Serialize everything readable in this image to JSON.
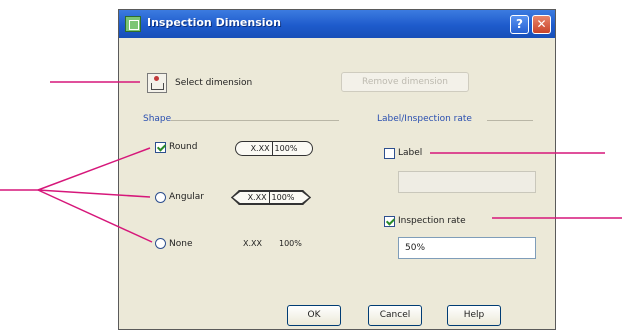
{
  "dialog": {
    "title": "Inspection Dimension",
    "help_glyph": "?",
    "close_glyph": "✕",
    "select_label": "Select dimension",
    "remove_label": "Remove dimension"
  },
  "shape": {
    "group_label": "Shape",
    "round_label": "Round",
    "round_checked": true,
    "angular_label": "Angular",
    "none_label": "None",
    "sample_value": "X.XX",
    "sample_rate": "100%"
  },
  "label_rate": {
    "group_label": "Label/Inspection rate",
    "label_label": "Label",
    "label_checked": false,
    "label_value": "",
    "rate_label": "Inspection rate",
    "rate_checked": true,
    "rate_value": "50%"
  },
  "buttons": {
    "ok": "OK",
    "cancel": "Cancel",
    "help": "Help"
  },
  "colors": {
    "titlebar": "#1e5bcc",
    "dialog_bg": "#ece9d8",
    "group_label": "#2a4fb0",
    "callout": "#d6177a"
  }
}
